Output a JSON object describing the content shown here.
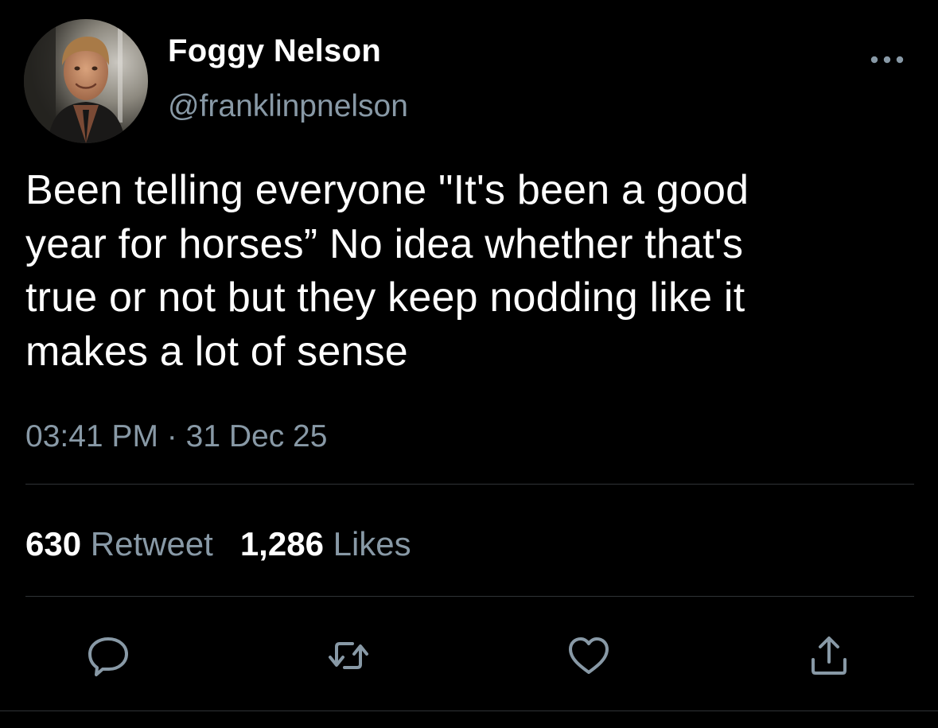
{
  "tweet": {
    "display_name": "Foggy Nelson",
    "handle": "@franklinpnelson",
    "text": "Been telling everyone \"It's been a good\nyear for horses” No idea whether that's\ntrue or not but they keep nodding like it\nmakes a lot of sense",
    "time": "03:41 PM",
    "separator": "·",
    "date": "31 Dec 25",
    "retweet_count": "630",
    "retweet_label": "Retweet",
    "like_count": "1,286",
    "like_label": "Likes"
  },
  "icons": {
    "more": "more-options-icon",
    "reply": "reply-icon",
    "retweet": "retweet-icon",
    "like": "heart-icon",
    "share": "share-icon"
  },
  "colors": {
    "background": "#000000",
    "text": "#ffffff",
    "secondary": "#8899a6",
    "divider": "#2f3336"
  }
}
